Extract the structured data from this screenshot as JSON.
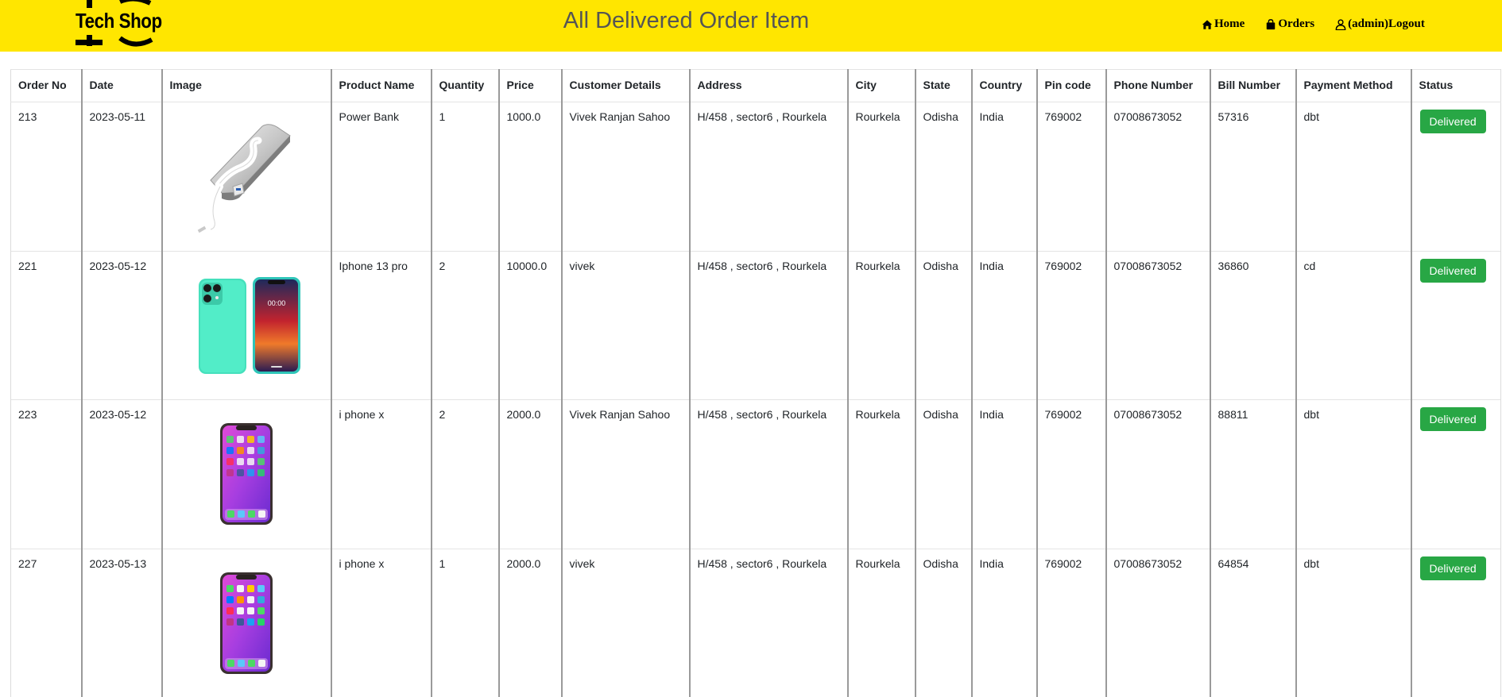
{
  "header": {
    "logo_text": "Tech Shop",
    "title": "All Delivered Order Item",
    "nav": [
      {
        "icon": "home-icon",
        "label": "Home"
      },
      {
        "icon": "shopping-bag-icon",
        "label": "Orders"
      },
      {
        "icon": "user-icon",
        "label": "(admin)Logout"
      }
    ],
    "bar_color": "#ffe600"
  },
  "table": {
    "columns": [
      "Order No",
      "Date",
      "Image",
      "Product Name",
      "Quantity",
      "Price",
      "Customer Details",
      "Address",
      "City",
      "State",
      "Country",
      "Pin code",
      "Phone Number",
      "Bill Number",
      "Payment Method",
      "Status"
    ],
    "rows": [
      {
        "order_no": "213",
        "date": "2023-05-11",
        "image": "power-bank-image",
        "product": "Power Bank",
        "quantity": "1",
        "price": "1000.0",
        "customer": "Vivek Ranjan Sahoo",
        "address": "H/458 , sector6 , Rourkela",
        "city": "Rourkela",
        "state": "Odisha",
        "country": "India",
        "pin": "769002",
        "phone": "07008673052",
        "bill": "57316",
        "payment": "dbt",
        "status": "Delivered"
      },
      {
        "order_no": "221",
        "date": "2023-05-12",
        "image": "iphone-13-pro-image",
        "product": "Iphone 13 pro",
        "quantity": "2",
        "price": "10000.0",
        "customer": "vivek",
        "address": "H/458 , sector6 , Rourkela",
        "city": "Rourkela",
        "state": "Odisha",
        "country": "India",
        "pin": "769002",
        "phone": "07008673052",
        "bill": "36860",
        "payment": "cd",
        "status": "Delivered"
      },
      {
        "order_no": "223",
        "date": "2023-05-12",
        "image": "iphone-x-image",
        "product": "i phone x",
        "quantity": "2",
        "price": "2000.0",
        "customer": "Vivek Ranjan Sahoo",
        "address": "H/458 , sector6 , Rourkela",
        "city": "Rourkela",
        "state": "Odisha",
        "country": "India",
        "pin": "769002",
        "phone": "07008673052",
        "bill": "88811",
        "payment": "dbt",
        "status": "Delivered"
      },
      {
        "order_no": "227",
        "date": "2023-05-13",
        "image": "iphone-x-image",
        "product": "i phone x",
        "quantity": "1",
        "price": "2000.0",
        "customer": "vivek",
        "address": "H/458 , sector6 , Rourkela",
        "city": "Rourkela",
        "state": "Odisha",
        "country": "India",
        "pin": "769002",
        "phone": "07008673052",
        "bill": "64854",
        "payment": "dbt",
        "status": "Delivered"
      }
    ],
    "status_color": "#28a745"
  }
}
